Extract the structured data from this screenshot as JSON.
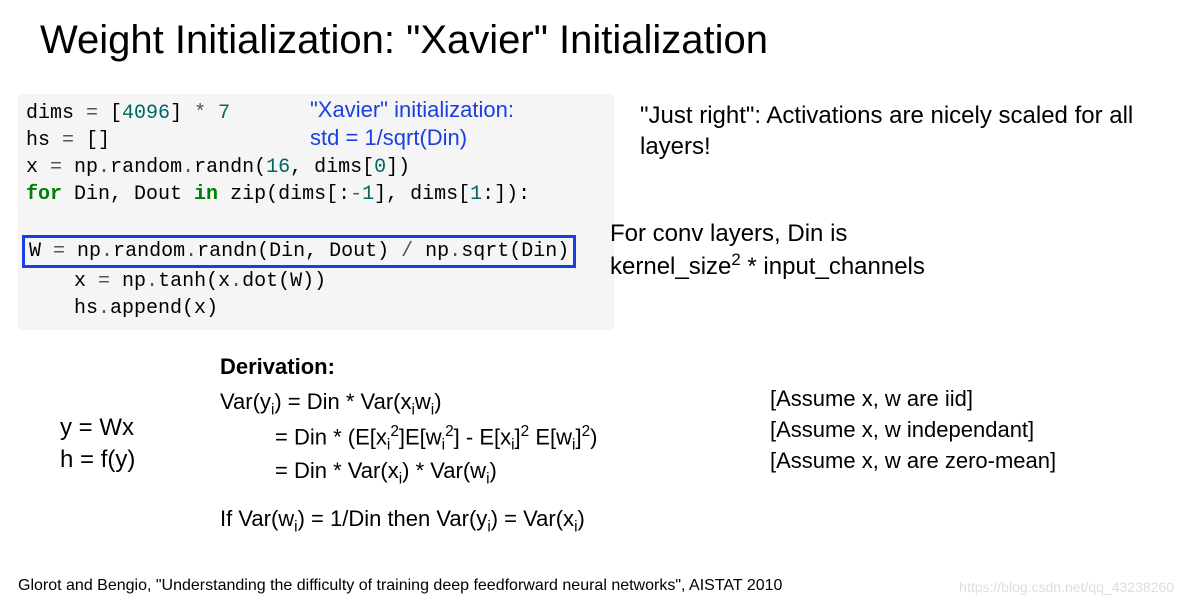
{
  "title": "Weight Initialization: \"Xavier\" Initialization",
  "code": {
    "l1a": "dims ",
    "l1b": "=",
    "l1c": " [",
    "l1d": "4096",
    "l1e": "] ",
    "l1f": "*",
    "l1g": " ",
    "l1h": "7",
    "l2a": "hs ",
    "l2b": "=",
    "l2c": " []",
    "l3a": "x ",
    "l3b": "=",
    "l3c": " np",
    "l3d": ".",
    "l3e": "random",
    "l3f": ".",
    "l3g": "randn(",
    "l3h": "16",
    "l3i": ", dims[",
    "l3j": "0",
    "l3k": "])",
    "l4a": "for",
    "l4b": " Din, Dout ",
    "l4c": "in",
    "l4d": " zip(dims[:",
    "l4e": "-",
    "l4f": "1",
    "l4g": "], dims[",
    "l4h": "1",
    "l4i": ":]):",
    "l5a": "W ",
    "l5b": "=",
    "l5c": " np",
    "l5d": ".",
    "l5e": "random",
    "l5f": ".",
    "l5g": "randn(Din, Dout) ",
    "l5h": "/",
    "l5i": " np",
    "l5j": ".",
    "l5k": "sqrt(Din)",
    "l6a": "x ",
    "l6b": "=",
    "l6c": " np",
    "l6d": ".",
    "l6e": "tanh(x",
    "l6f": ".",
    "l6g": "dot(W))",
    "l7a": "hs",
    "l7b": ".",
    "l7c": "append(x)"
  },
  "xavier": {
    "line1": "\"Xavier\" initialization:",
    "line2": "std = 1/sqrt(Din)"
  },
  "right1": "\"Just right\": Activations are nicely scaled for all layers!",
  "right2a": "For conv layers, Din is",
  "right2b": "kernel_size",
  "right2c": " * input_channels",
  "eqs": {
    "y": "y = Wx",
    "h": "h = f(y)"
  },
  "deriv": {
    "head": "Derivation:",
    "r1a": "Var(y",
    "r1b": ") = Din * Var(x",
    "r1c": "w",
    "r1d": ")",
    "r2a": "         = Din * (E[x",
    "r2b": "]E[w",
    "r2c": "] - E[x",
    "r2d": "]",
    "r2e": " E[w",
    "r2f": "]",
    "r2g": ")",
    "r3a": "         = Din * Var(x",
    "r3b": ") * Var(w",
    "r3c": ")",
    "r4a": "If Var(w",
    "r4b": ") = 1/Din then Var(y",
    "r4c": ") = Var(x",
    "r4d": ")"
  },
  "assump": {
    "a1": "[Assume x, w are iid]",
    "a2": "[Assume x, w independant]",
    "a3": "[Assume x, w are zero-mean]"
  },
  "citation": "Glorot and Bengio, \"Understanding the difficulty of training deep feedforward neural networks\", AISTAT 2010",
  "watermark": "https://blog.csdn.net/qq_43238260"
}
